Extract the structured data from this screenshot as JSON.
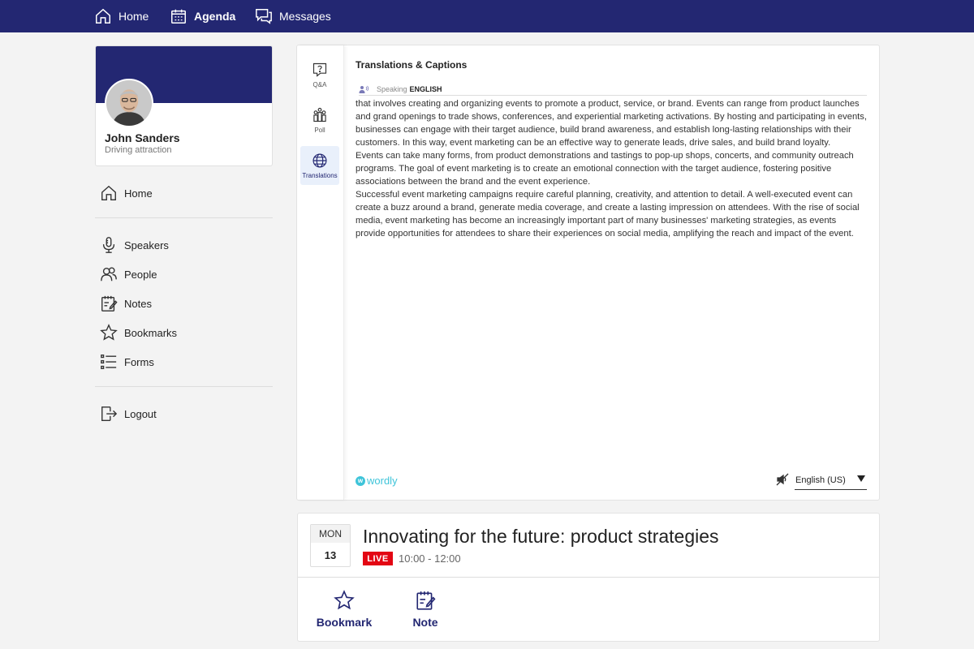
{
  "topnav": {
    "items": [
      {
        "label": "Home",
        "icon": "home-icon"
      },
      {
        "label": "Agenda",
        "icon": "calendar-icon"
      },
      {
        "label": "Messages",
        "icon": "messages-icon"
      }
    ],
    "active": "Agenda"
  },
  "profile": {
    "name": "John Sanders",
    "subtitle": "Driving attraction"
  },
  "sidebar": {
    "items": [
      {
        "label": "Home",
        "icon": "home-icon"
      },
      {
        "label": "Speakers",
        "icon": "microphone-icon"
      },
      {
        "label": "People",
        "icon": "people-icon"
      },
      {
        "label": "Notes",
        "icon": "notes-icon"
      },
      {
        "label": "Bookmarks",
        "icon": "star-icon"
      },
      {
        "label": "Forms",
        "icon": "list-icon"
      },
      {
        "label": "Logout",
        "icon": "logout-icon"
      }
    ]
  },
  "panel": {
    "tabs": [
      {
        "label": "Q&A",
        "icon": "question-icon"
      },
      {
        "label": "Poll",
        "icon": "poll-icon"
      },
      {
        "label": "Translations",
        "icon": "globe-icon"
      }
    ],
    "active_tab": "Translations",
    "title": "Translations & Captions",
    "speaking_label": "Speaking",
    "speaking_language": "ENGLISH",
    "paragraphs": [
      "that involves creating and organizing events to promote a product, service, or brand. Events can range from product launches and grand openings to trade shows, conferences, and experiential marketing activations. By hosting and participating in events, businesses can engage with their target audience, build brand awareness, and establish long-lasting relationships with their customers. In this way, event marketing can be an effective way to generate leads, drive sales, and build brand loyalty.",
      "Events can take many forms, from product demonstrations and tastings to pop-up shops, concerts, and community outreach programs. The goal of event marketing is to create an emotional connection with the target audience, fostering positive associations between the brand and the event experience.",
      "Successful event marketing campaigns require careful planning, creativity, and attention to detail. A well-executed event can create a buzz around a brand, generate media coverage, and create a lasting impression on attendees. With the rise of social media, event marketing has become an increasingly important part of many businesses' marketing strategies, as events provide opportunities for attendees to share their experiences on social media, amplifying the reach and impact of the event."
    ],
    "brand_badge": "w",
    "brand": "wordly",
    "language_select": "English (US)"
  },
  "session": {
    "day": "MON",
    "date": "13",
    "title": "Innovating for the future: product strategies",
    "live_label": "LIVE",
    "time": "10:00 - 12:00",
    "actions": [
      {
        "label": "Bookmark",
        "icon": "star-icon"
      },
      {
        "label": "Note",
        "icon": "note-icon"
      }
    ]
  },
  "colors": {
    "brand_navy": "#232772",
    "live_red": "#e30613",
    "wordly_teal": "#3ec4d9"
  }
}
